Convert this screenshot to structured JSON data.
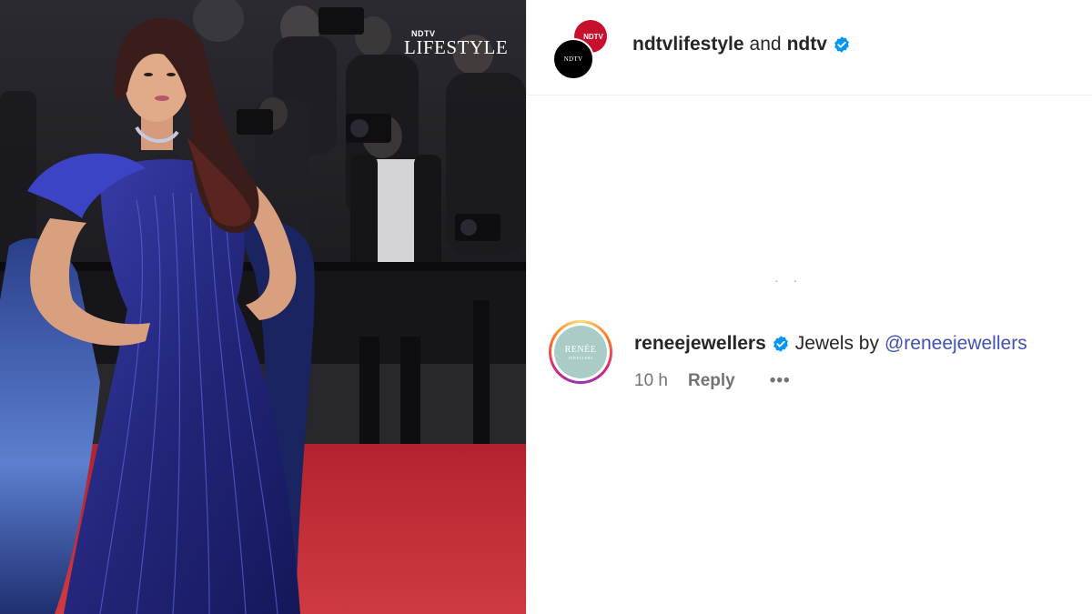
{
  "photo": {
    "watermark_top": "NDTV",
    "watermark_main": "LIFESTYLE"
  },
  "post_header": {
    "avatar_back_text": "NDTV",
    "avatar_front_text": "NDTV",
    "username_primary": "ndtvlifestyle",
    "connector": "and",
    "username_secondary": "ndtv",
    "verified_icon": "verified-badge-icon"
  },
  "colors": {
    "verified_blue": "#0095f6",
    "mention": "#3f51b5",
    "red_carpet": "#c0303a",
    "gown": "#2a2f8f"
  },
  "comment": {
    "avatar_logo": "RENÉE",
    "avatar_logo_sub": "JEWELLERS",
    "username": "reneejewellers",
    "text": "Jewels by",
    "mention": "@reneejewellers",
    "time": "10 h",
    "reply_label": "Reply",
    "more_label": "•••"
  }
}
